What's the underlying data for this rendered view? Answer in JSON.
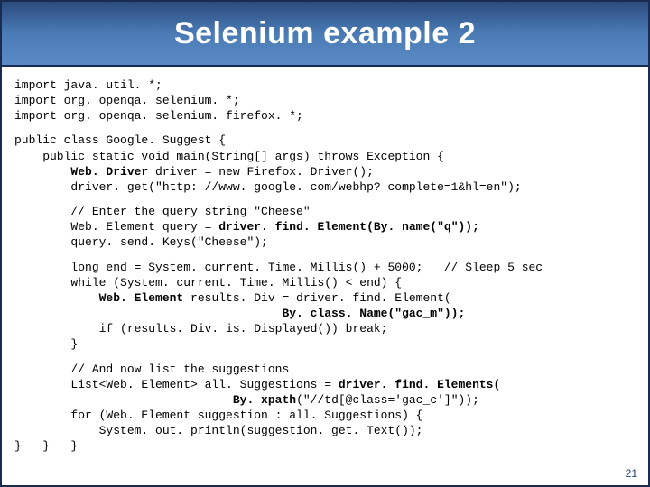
{
  "title": "Selenium example 2",
  "page_number": "21",
  "imports": "import java. util. *;\nimport org. openqa. selenium. *;\nimport org. openqa. selenium. firefox. *;",
  "class_open": "public class Google. Suggest {\n    public static void main(String[] args) throws Exception {",
  "driver_a": "        Web. Driver",
  "driver_b": " driver = new Firefox. Driver();\n        driver. get(\"http: //www. google. com/webhp? complete=1&hl=en\");",
  "cheese_a": "        // Enter the query string \"Cheese\"\n        Web. Element query = ",
  "cheese_b": "driver. find. Element(By. name(\"q\"));",
  "cheese_c": "        query. send. Keys(\"Cheese\");",
  "loop_a": "        long end = System. current. Time. Millis() + 5000;   // Sleep 5 sec\n        while (System. current. Time. Millis() < end) {",
  "loop_b": "            Web. Element",
  "loop_c": " results. Div = driver. find. Element(",
  "loop_d": "                                      By. class. Name(\"gac_m\"));",
  "loop_e": "            if (results. Div. is. Displayed()) break;\n        }",
  "suggest_a": "        // And now list the suggestions\n        List<Web. Element> all. Suggestions = ",
  "suggest_b": "driver. find. Elements(",
  "suggest_c": "                               By. xpath",
  "suggest_d": "(\"//td[@class='gac_c']\"));\n        for (Web. Element suggestion : all. Suggestions) {\n            System. out. println(suggestion. get. Text());\n}   }   }"
}
